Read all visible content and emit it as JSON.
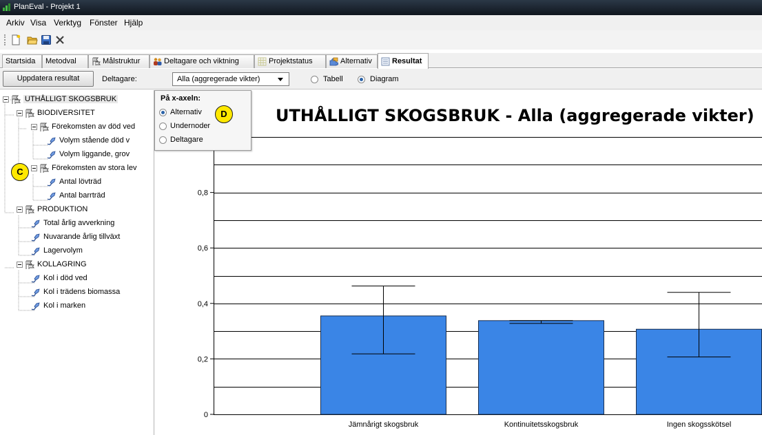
{
  "window": {
    "title": "PlanEval - Projekt 1"
  },
  "menu": [
    "Arkiv",
    "Visa",
    "Verktyg",
    "Fönster",
    "Hjälp"
  ],
  "toolbar": [
    "new-icon",
    "open-folder-icon",
    "save-icon",
    "delete-icon"
  ],
  "tabs": [
    {
      "label": "Startsida",
      "icon": ""
    },
    {
      "label": "Metodval",
      "icon": ""
    },
    {
      "label": "Målstruktur",
      "icon": "flag-tree-icon"
    },
    {
      "label": "Deltagare och viktning",
      "icon": "people-icon"
    },
    {
      "label": "Projektstatus",
      "icon": "grid-icon"
    },
    {
      "label": "Alternativ",
      "icon": "puzzle-icon"
    },
    {
      "label": "Resultat",
      "icon": "chart-icon",
      "active": true
    }
  ],
  "actions": {
    "update_button": "Uppdatera resultat",
    "participants_label": "Deltagare:",
    "participants_value": "Alla (aggregerade vikter)",
    "view_table": "Tabell",
    "view_diagram": "Diagram",
    "selected_view": "Diagram"
  },
  "tree": [
    {
      "label": "UTHÅLLIGT SKOGSBRUK",
      "level": 0,
      "type": "goal",
      "expanded": true
    },
    {
      "label": "BIODIVERSITET",
      "level": 1,
      "type": "goal",
      "expanded": true
    },
    {
      "label": "Förekomsten av död ved",
      "level": 2,
      "type": "goal",
      "expanded": true
    },
    {
      "label": "Volym stående död v",
      "level": 3,
      "type": "criterion"
    },
    {
      "label": "Volym liggande, grov",
      "level": 3,
      "type": "criterion"
    },
    {
      "label": "Förekomsten av stora lev",
      "level": 2,
      "type": "goal",
      "expanded": true
    },
    {
      "label": "Antal lövträd",
      "level": 3,
      "type": "criterion"
    },
    {
      "label": "Antal barrträd",
      "level": 3,
      "type": "criterion"
    },
    {
      "label": "PRODUKTION",
      "level": 1,
      "type": "goal",
      "expanded": true
    },
    {
      "label": "Total årlig avverkning",
      "level": 2,
      "type": "criterion"
    },
    {
      "label": "Nuvarande årlig tillväxt",
      "level": 2,
      "type": "criterion"
    },
    {
      "label": "Lagervolym",
      "level": 2,
      "type": "criterion"
    },
    {
      "label": "KOLLAGRING",
      "level": 1,
      "type": "goal",
      "expanded": true
    },
    {
      "label": "Kol i död ved",
      "level": 2,
      "type": "criterion"
    },
    {
      "label": "Kol i trädens biomassa",
      "level": 2,
      "type": "criterion"
    },
    {
      "label": "Kol i marken",
      "level": 2,
      "type": "criterion"
    }
  ],
  "xaxis_popup": {
    "title": "På x-axeln:",
    "options": [
      "Alternativ",
      "Undernoder",
      "Deltagare"
    ],
    "selected": "Alternativ"
  },
  "markers": [
    "C",
    "D"
  ],
  "colors": {
    "bar": "#3a85e6",
    "bar_edge": "#1a2f4f",
    "titlebar": "#1b2430"
  },
  "chart_data": {
    "type": "bar",
    "title": "UTHÅLLIGT SKOGSBRUK - Alla (aggregerade vikter)",
    "categories": [
      "Jämnårigt skogsbruk",
      "Kontinuitetsskogsbruk",
      "Ingen skogsskötsel"
    ],
    "values": [
      0.355,
      0.338,
      0.307
    ],
    "error_low": [
      0.218,
      0.328,
      0.207
    ],
    "error_high": [
      0.463,
      0.338,
      0.44
    ],
    "ylim": [
      0,
      1.02
    ],
    "yticks": [
      0,
      0.2,
      0.4,
      0.6,
      0.8
    ],
    "ytick_labels": [
      "0",
      "0,2",
      "0,4",
      "0,6",
      "0,8"
    ],
    "grid": true,
    "legend": "none"
  }
}
